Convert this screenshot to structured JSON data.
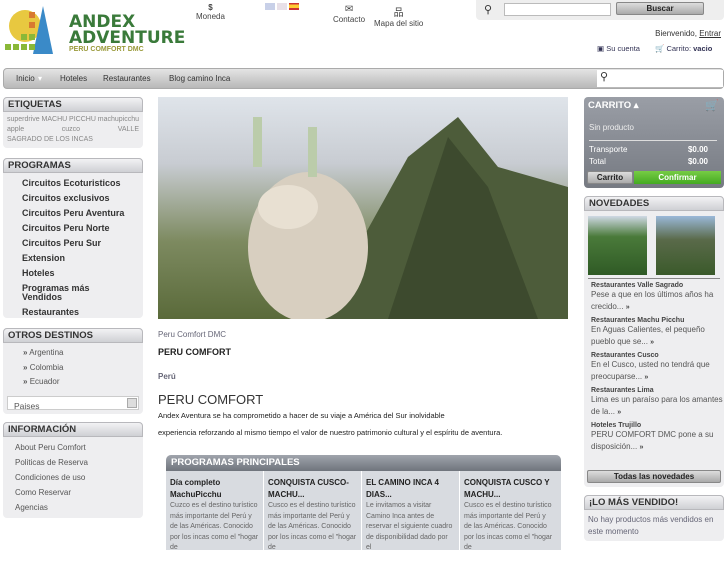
{
  "header": {
    "logo_line1": "ANDEX",
    "logo_line2": "ADVENTURE",
    "logo_sub": "PERU COMFORT DMC",
    "currency_symbol": "$",
    "currency_label": "Moneda",
    "contact": "Contacto",
    "sitemap": "Mapa del sitio",
    "search_button": "Buscar",
    "welcome": "Bienvenido,",
    "login": "Entrar",
    "account": "Su cuenta",
    "cart": "Carrito:",
    "cart_state": "vacio"
  },
  "nav": {
    "items": [
      "Inicio",
      "Hoteles",
      "Restaurantes",
      "Blog camino Inca"
    ]
  },
  "left": {
    "tags_title": "ETIQUETAS",
    "tags": [
      "superdrive",
      "MACHU",
      "PICCHU",
      "machupicchu",
      "apple",
      "cuzco",
      "VALLE",
      "SAGRADO DE LOS INCAS"
    ],
    "programs_title": "PROGRAMAS",
    "programs": [
      "Circuitos Ecoturisticos",
      "Circuitos exclusivos",
      "Circuitos Peru Aventura",
      "Circuitos Peru Norte",
      "Circuitos Peru Sur",
      "Extension",
      "Hoteles",
      "Programas más Vendidos",
      "Restaurantes"
    ],
    "dest_title": "OTROS DESTINOS",
    "destinations": [
      "Argentina",
      "Colombia",
      "Ecuador"
    ],
    "dest_select": "Paises",
    "info_title": "INFORMACIÓN",
    "info": [
      "About Peru Comfort",
      "Politicas de Reserva",
      "Condiciones de uso",
      "Como Reservar",
      "Agencias"
    ]
  },
  "main": {
    "caption": "Peru Comfort DMC",
    "heading1": "PERU COMFORT",
    "country": "Perú",
    "heading2": "PERU COMFORT",
    "intro1": "Andex Aventura se ha comprometido a hacer de su viaje a América del Sur inolvidable",
    "intro2": "experiencia reforzando al mismo tiempo el valor de nuestro patrimonio cultural y el espíritu de aventura.",
    "programs_title": "PROGRAMAS PRINCIPALES",
    "programs": [
      {
        "title": "Día completo MachuPicchu",
        "text": "Cuzco es el destino turístico más importante del Perú y de las Américas. Conocido por los incas como el \"hogar de"
      },
      {
        "title": "CONQUISTA CUSCO-MACHU...",
        "text": "Cusco es el destino turístico más importante del Perú y de las Américas. Conocido por los incas como el \"hogar de"
      },
      {
        "title": "EL CAMINO INCA 4 DIAS...",
        "text": "Le invitamos a visitar Camino Inca antes de reservar el siguiente cuadro de disponibilidad dado por el"
      },
      {
        "title": "CONQUISTA CUSCO Y MACHU...",
        "text": "Cusco es el destino turístico más importante del Perú y de las Américas. Conocido por los incas como el \"hogar de"
      }
    ]
  },
  "right": {
    "cart_title": "CARRITO",
    "no_product": "Sin producto",
    "shipping_label": "Transporte",
    "shipping": "$0.00",
    "total_label": "Total",
    "total": "$0.00",
    "cart_button": "Carrito",
    "confirm_button": "Confirmar",
    "news_title": "NOVEDADES",
    "news": [
      {
        "title": "Restaurantes Valle Sagrado",
        "text": "Pese a que en los últimos años ha crecido..."
      },
      {
        "title": "Restaurantes Machu Picchu",
        "text": "En Aguas Calientes, el pequeño pueblo que se..."
      },
      {
        "title": "Restaurantes Cusco",
        "text": "En el Cusco, usted no tendrá que preocuparse..."
      },
      {
        "title": "Restaurantes Lima",
        "text": "Lima es un paraíso para los amantes de la..."
      },
      {
        "title": "Hoteles Trujillo",
        "text": "PERU COMFORT DMC pone a su disposición..."
      }
    ],
    "all_news": "Todas las novedades",
    "best_title": "¡LO MÁS VENDIDO!",
    "best_text": "No hay productos más vendidos en este momento",
    "more_arrow": "»"
  }
}
